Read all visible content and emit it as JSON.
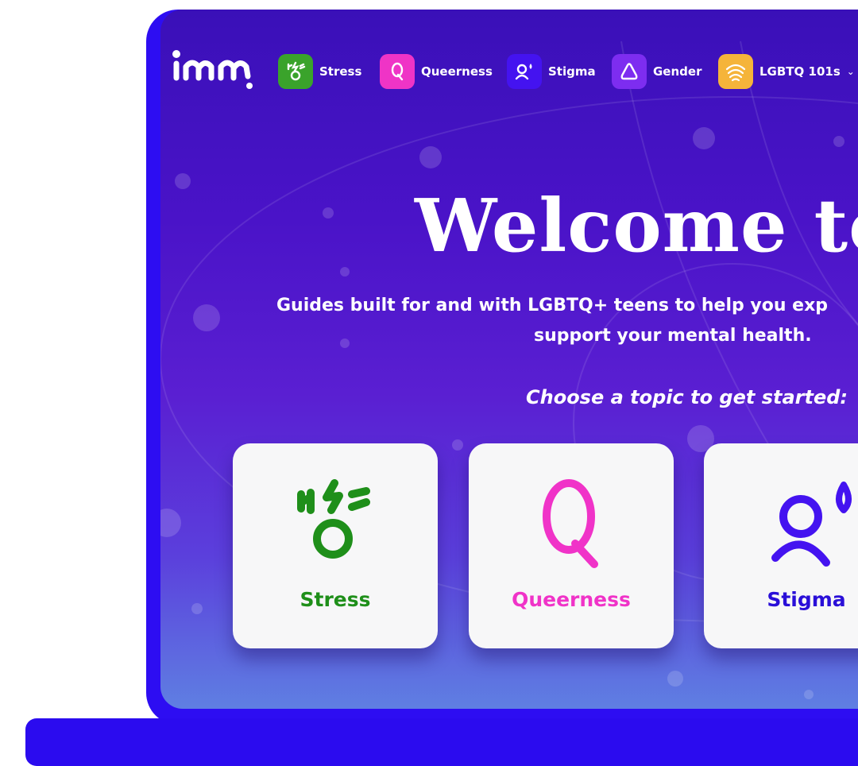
{
  "nav": {
    "items": [
      {
        "label": "Stress",
        "icon": "stress-icon",
        "color": "#3aa32b"
      },
      {
        "label": "Queerness",
        "icon": "queerness-icon",
        "color": "#ef34c6"
      },
      {
        "label": "Stigma",
        "icon": "stigma-icon",
        "color": "#4413f0"
      },
      {
        "label": "Gender",
        "icon": "gender-icon",
        "color": "#7d2df0"
      },
      {
        "label": "LGBTQ 101s",
        "icon": "lgbtq-101s-icon",
        "color": "#f5b43a"
      }
    ]
  },
  "hero": {
    "title": "Welcome to i",
    "subtitle_line1": "Guides built for and with LGBTQ+ teens to help you exp",
    "subtitle_line2": "support your mental health.",
    "prompt": "Choose a topic to get started:"
  },
  "cards": [
    {
      "label": "Stress",
      "color": "#1f8f1a"
    },
    {
      "label": "Queerness",
      "color": "#f033c8"
    },
    {
      "label": "Stigma",
      "color": "#2a0fd8"
    }
  ],
  "colors": {
    "frame": "#2d0df2",
    "background_top": "#3a10b8",
    "background_bottom": "#5f7fe2"
  }
}
